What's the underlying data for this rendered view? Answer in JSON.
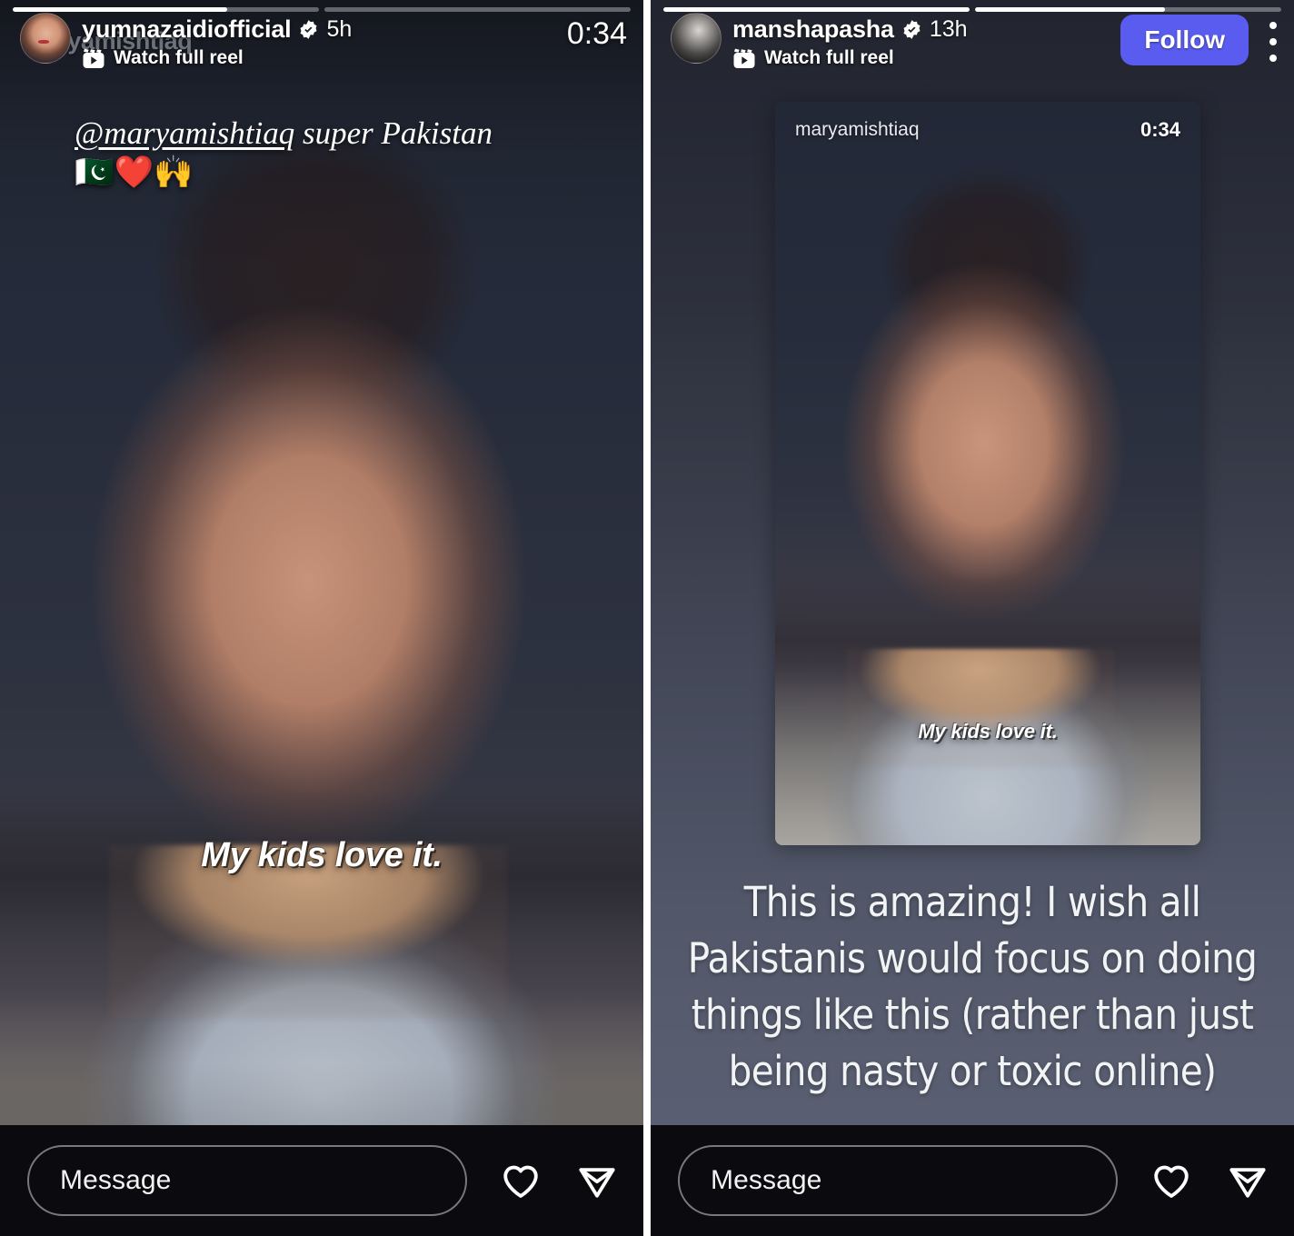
{
  "app": "instagram-stories",
  "panels": [
    {
      "id": "left",
      "progress": {
        "segments": 2,
        "fills": [
          0.7,
          0.0
        ]
      },
      "header": {
        "username": "yumnazaidiofficial",
        "verified_icon": "verified-badge-icon",
        "timestamp": "5h",
        "reel_icon": "reels-clapper-icon",
        "reel_label": "Watch full reel",
        "duration": "0:34",
        "ghost_username": "maryamishtiaq",
        "avatar_icon": "avatar-yumnazaidiofficial"
      },
      "sticker": {
        "mention": "@maryamishtiaq",
        "rest": " super Pakistan ",
        "emoji": "🇵🇰❤️🙌"
      },
      "caption": "My kids love it.",
      "footer": {
        "message_placeholder": "Message",
        "like_icon": "heart-icon",
        "share_icon": "share-paper-plane-icon"
      }
    },
    {
      "id": "right",
      "progress": {
        "segments": 2,
        "fills": [
          1.0,
          0.62
        ]
      },
      "header": {
        "username": "manshapasha",
        "verified_icon": "verified-badge-icon",
        "timestamp": "13h",
        "reel_icon": "reels-clapper-icon",
        "reel_label": "Watch full reel",
        "follow_label": "Follow",
        "follow_color": "#5a5cf0",
        "more_icon": "kebab-menu-icon",
        "avatar_icon": "avatar-manshapasha"
      },
      "card": {
        "username": "maryamishtiaq",
        "duration": "0:34",
        "caption": "My kids love it."
      },
      "reshare_text": "This is amazing! I wish all Pakistanis would focus on doing things like this (rather than just being nasty or toxic online)",
      "footer": {
        "message_placeholder": "Message",
        "like_icon": "heart-icon",
        "share_icon": "share-paper-plane-icon"
      }
    }
  ],
  "colors": {
    "follow_blue": "#5a5cf0",
    "bar_black": "#0b0b0f",
    "text_white": "#ffffff",
    "reshare_bg_top": "#22242f",
    "reshare_bg_bottom": "#5b6175"
  }
}
